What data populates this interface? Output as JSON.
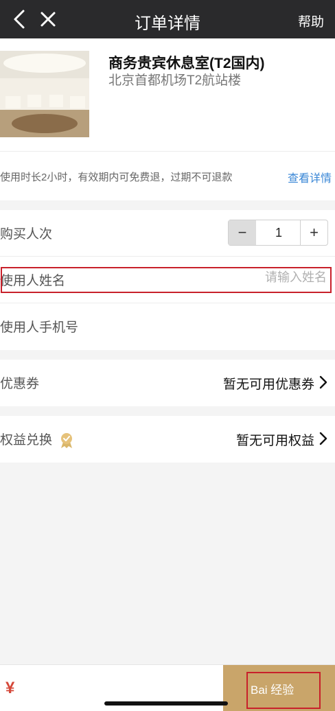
{
  "nav": {
    "title": "订单详情",
    "help": "帮助"
  },
  "product": {
    "name": "商务贵宾休息室(T2国内)",
    "location": "北京首都机场T2航站楼"
  },
  "policy": {
    "text": "使用时长2小时，有效期内可免费退，过期不可退款",
    "link": "查看详情"
  },
  "form": {
    "quantity_label": "购买人次",
    "quantity": "1",
    "minus": "−",
    "plus": "+",
    "name_label": "使用人姓名",
    "name_placeholder": "请输入姓名",
    "phone_label": "使用人手机号"
  },
  "coupon": {
    "label": "优惠券",
    "value": "暂无可用优惠券"
  },
  "rights": {
    "label": "权益兑换",
    "value": "暂无可用权益",
    "icon": "badge-icon"
  },
  "bottom": {
    "currency": "¥",
    "pay_label": "Bai 经验"
  },
  "colors": {
    "nav_bg": "#2a2a2c",
    "link": "#3a87d6",
    "price": "#d5483a",
    "pay_bg": "#c9a56a",
    "highlight": "#c8202a"
  }
}
